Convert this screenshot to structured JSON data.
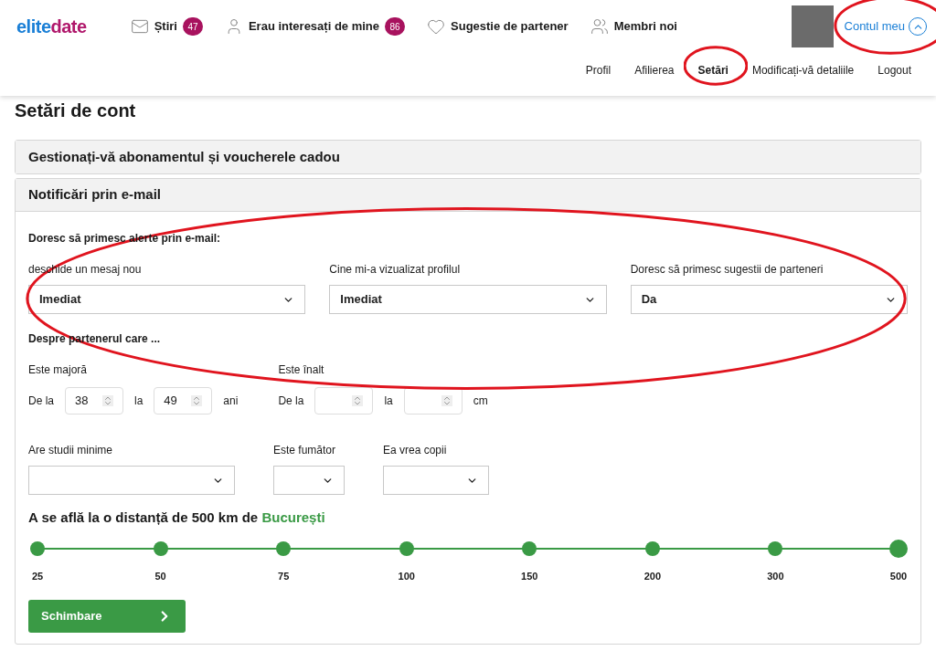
{
  "logo": {
    "part_1": "elite",
    "part_2": "date"
  },
  "nav": [
    {
      "kind": "mail",
      "label": "Știri",
      "badge": "47"
    },
    {
      "kind": "person",
      "label": "Erau interesați de mine",
      "badge": "86"
    },
    {
      "kind": "heart",
      "label": "Sugestie de partener"
    },
    {
      "kind": "people",
      "label": "Membri noi"
    }
  ],
  "account": {
    "label": "Contul meu",
    "expanded": true,
    "circled": true
  },
  "subnav": [
    {
      "label": "Profil",
      "selected": false,
      "circled": false
    },
    {
      "label": "Afilierea",
      "selected": false,
      "circled": false
    },
    {
      "label": "Setări",
      "selected": true,
      "circled": true
    },
    {
      "label": "Modificați-vă detaliile",
      "selected": false,
      "circled": false
    },
    {
      "label": "Logout",
      "selected": false,
      "circled": false
    }
  ],
  "page_title": "Setări de cont",
  "sections": [
    {
      "title": "Gestionați-vă abonamentul și voucherele cadou",
      "expanded": false
    },
    {
      "title": "Notificări prin e-mail",
      "expanded": true
    }
  ],
  "email_alerts": {
    "heading": "Doresc să primesc alerte prin e-mail:",
    "circled": true,
    "selects": [
      {
        "label": "deschide un mesaj nou",
        "value": "Imediat"
      },
      {
        "label": "Cine mi-a vizualizat profilul",
        "value": "Imediat"
      },
      {
        "label": "Doresc să primesc sugestii de parteneri",
        "value": "Da"
      }
    ]
  },
  "partner": {
    "heading": "Despre partenerul care ...",
    "ranges": [
      {
        "label": "Este majoră",
        "from": "De la",
        "min": "38",
        "to": "la",
        "max": "49",
        "unit": "ani"
      },
      {
        "label": "Este înalt",
        "from": "De la",
        "to": "la",
        "unit": "cm"
      }
    ],
    "selects": [
      {
        "label": "Are studii minime"
      },
      {
        "label": "Este fumător"
      },
      {
        "label": "Ea vrea copii"
      }
    ]
  },
  "distance": {
    "text": "A se află la o distanță de 500 km de",
    "city": "București",
    "level": 1,
    "stops": [
      {
        "label": "25",
        "selected": false
      },
      {
        "label": "50",
        "selected": false
      },
      {
        "label": "75",
        "selected": false
      },
      {
        "label": "100",
        "selected": false
      },
      {
        "label": "150",
        "selected": false
      },
      {
        "label": "200",
        "selected": false
      },
      {
        "label": "300",
        "selected": false
      },
      {
        "label": "500",
        "selected": true
      }
    ]
  },
  "submit": "Schimbare"
}
